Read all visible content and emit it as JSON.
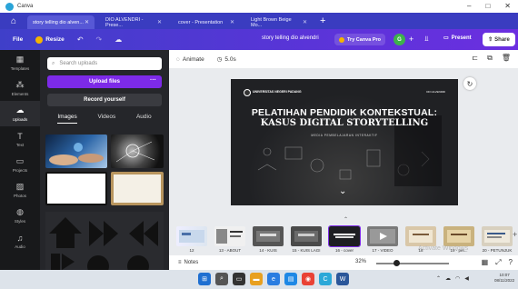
{
  "window": {
    "app_title": "Canva",
    "controls": [
      "–",
      "□",
      "✕"
    ]
  },
  "tabs": [
    {
      "label": "story telling dio alven...",
      "active": true
    },
    {
      "label": "DIO ALVENDRI - Prese...",
      "active": false
    },
    {
      "label": "cover - Presentation",
      "active": false
    },
    {
      "label": "Light Brown Beige Mo...",
      "active": false
    }
  ],
  "menubar": {
    "file": "File",
    "resize": "Resize",
    "doc_title": "story telling dio alvendri",
    "try_pro": "Try Canva Pro",
    "avatar_letter": "G",
    "present": "Present",
    "share": "Share"
  },
  "rail": [
    {
      "label": "Templates",
      "icon": "▦"
    },
    {
      "label": "Elements",
      "icon": "⁂"
    },
    {
      "label": "Uploads",
      "icon": "☁",
      "active": true
    },
    {
      "label": "Text",
      "icon": "T"
    },
    {
      "label": "Projects",
      "icon": "▭"
    },
    {
      "label": "Photos",
      "icon": "▨"
    },
    {
      "label": "Styles",
      "icon": "◍"
    },
    {
      "label": "Audio",
      "icon": "♫"
    }
  ],
  "panel": {
    "search_placeholder": "Search uploads",
    "upload_files": "Upload files",
    "upload_more": "···",
    "record_yourself": "Record yourself",
    "tabs": [
      "Images",
      "Videos",
      "Audio"
    ]
  },
  "editor": {
    "animate": "Animate",
    "duration": "5.0s",
    "notes": "Notes",
    "zoom": "32%",
    "zoom_level": 0.32
  },
  "slide": {
    "university": "UNIVERSITAS NEGERI PADANG",
    "author": "DIO ALVENDRI",
    "title_line1": "PELATIHAN PENDIDIK KONTEKSTUAL:",
    "title_line2": "KASUS DIGITAL STORYTELLING",
    "subtitle": "MEDIA PEMBELAJARAN INTERAKTIF"
  },
  "filmstrip": [
    {
      "label": "12"
    },
    {
      "label": "13 - ABOUT"
    },
    {
      "label": "14 - KUIS"
    },
    {
      "label": "15 - KUIS LAGI"
    },
    {
      "label": "16 - cover",
      "selected": true
    },
    {
      "label": "17 - VIDEO"
    },
    {
      "label": "18"
    },
    {
      "label": "19 - pet..."
    },
    {
      "label": "20 - PETUNJUK"
    }
  ],
  "watermark": "Activate Windows",
  "taskbar": {
    "time": "10:07",
    "date": "08/11/2022"
  },
  "colors": {
    "brand_purple": "#7d2ae8",
    "tab_bar": "#3a3cc0",
    "avatar_green": "#3db34a",
    "pro_gold": "#f5b400"
  }
}
